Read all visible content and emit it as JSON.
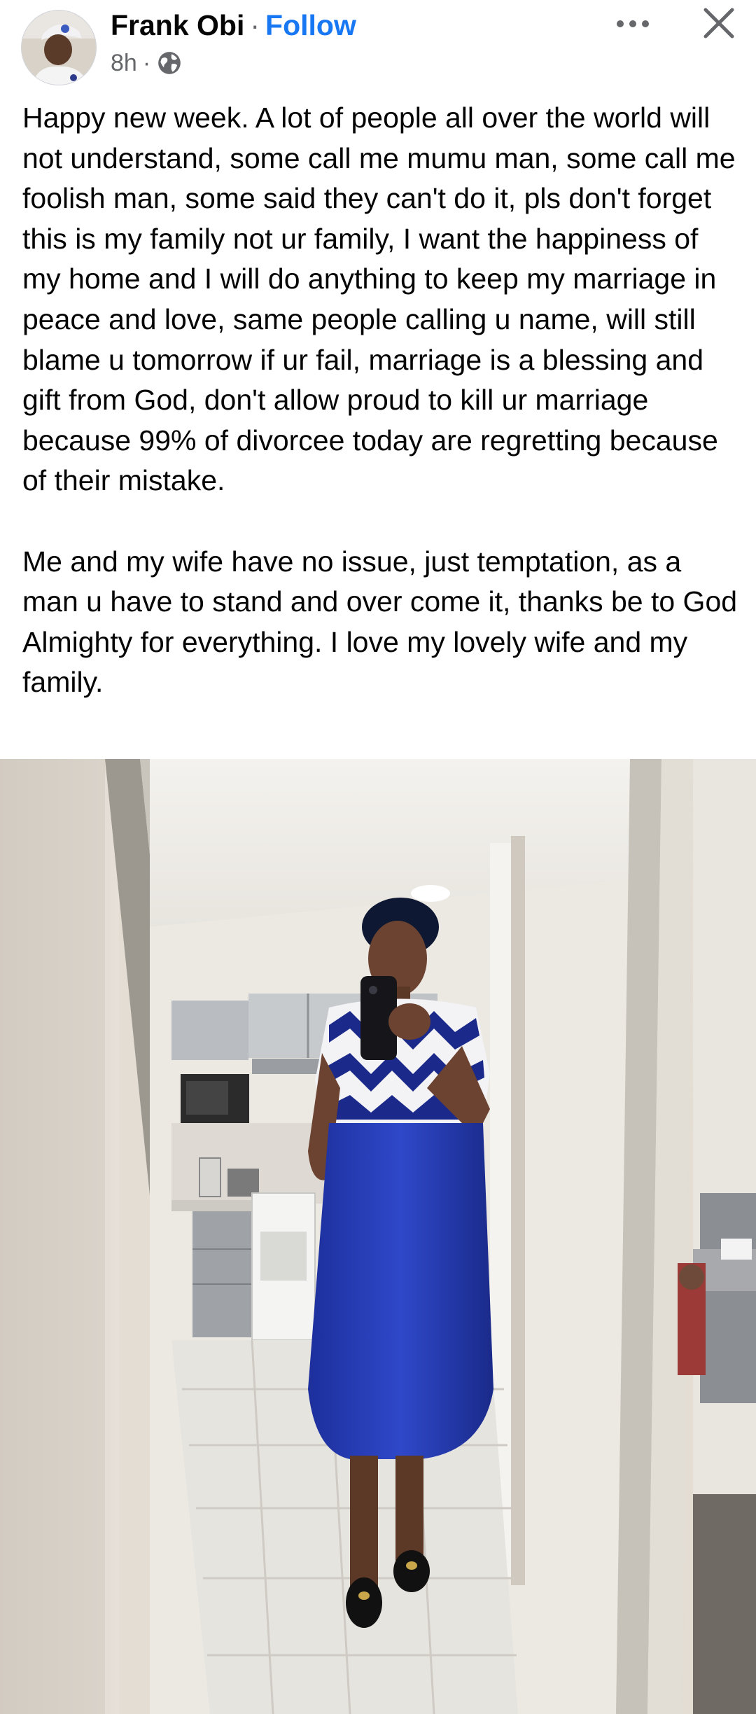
{
  "post": {
    "author": {
      "name": "Frank Obi",
      "follow_label": "Follow",
      "separator": "·"
    },
    "meta": {
      "time": "8h",
      "separator": "·",
      "audience_icon": "globe-icon"
    },
    "header_actions": {
      "more_icon": "more-options-icon",
      "close_icon": "close-icon"
    },
    "text": {
      "paragraph_1": "Happy new week. A lot of people all over the world will not understand, some call me mumu man, some call me foolish man, some said they can't do it, pls don't forget this is my family not ur family, I want the happiness of my home and I will do anything to keep my marriage in peace and love, same people calling u name, will still blame u tomorrow if ur fail, marriage is a blessing and gift from God, don't allow proud to kill ur marriage because 99% of divorcee today are regretting because of their mistake.",
      "paragraph_2": "Me and my wife have no issue, just temptation, as a man u have to stand and over come it, thanks be to God Almighty for everything. I love my lovely wife and my family."
    },
    "colors": {
      "follow": "#1877f2",
      "secondary_text": "#65676b",
      "primary_text": "#050505"
    }
  }
}
